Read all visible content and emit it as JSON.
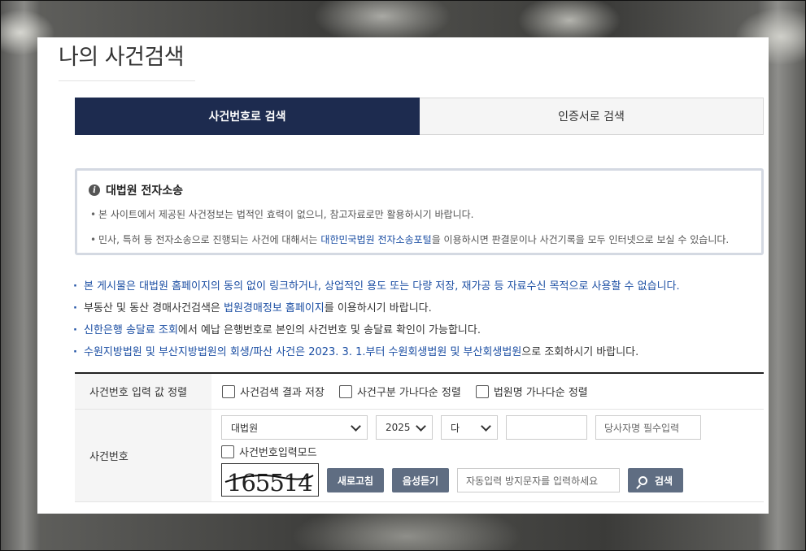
{
  "page": {
    "title": "나의 사건검색"
  },
  "tabs": [
    {
      "label": "사건번호로 검색",
      "active": true
    },
    {
      "label": "인증서로 검색",
      "active": false
    }
  ],
  "notice": {
    "title": "대법원 전자소송",
    "line1": "본 사이트에서 제공된 사건정보는 법적인 효력이 없으니, 참고자료로만 활용하시기 바랍니다.",
    "line2_pre": "민사, 특허 등 전자소송으로 진행되는 사건에 대해서는 ",
    "line2_link": "대한민국법원 전자소송포털",
    "line2_post": "을 이용하시면 판결문이나 사건기록을 모두 인터넷으로 보실 수 있습니다."
  },
  "bullets": {
    "b1": "본 게시물은 대법원 홈페이지의 동의 없이 링크하거나, 상업적인 용도 또는 다량 저장, 재가공 등 자료수신 목적으로 사용할 수 없습니다.",
    "b2_pre": "부동산 및 동산 경매사건검색은 ",
    "b2_link": "법원경매정보 홈페이지",
    "b2_post": "를 이용하시기 바랍니다.",
    "b3_link": "신한은행 송달료 조회",
    "b3_post": "에서 예납 은행번호로 본인의 사건번호 및 송달료 확인이 가능합니다.",
    "b4_pre": "수원지방법원 및 부산지방법원의 회생/파산 사건은 2023. 3. 1.부터 ",
    "b4_link": "수원회생법원 및 부산회생법원",
    "b4_post": "으로 조회하시기 바랍니다."
  },
  "form": {
    "sort_label": "사건번호 입력 값 정렬",
    "checkbox_save": "사건검색 결과 저장",
    "checkbox_type_sort": "사건구분 가나다순 정렬",
    "checkbox_court_sort": "법원명 가나다순 정렬",
    "case_label": "사건번호",
    "court_select": "대법원",
    "year_select": "2025",
    "type_select": "다",
    "case_number_value": "",
    "party_placeholder": "당사자명 필수입력",
    "input_mode_label": "사건번호입력모드",
    "captcha_text": "165514",
    "refresh_button": "새로고침",
    "audio_button": "음성듣기",
    "captcha_placeholder": "자동입력 방지문자를 입력하세요",
    "search_button": "검색"
  },
  "colors": {
    "active_tab": "#1d2b4f",
    "link_blue": "#1b4ea3",
    "button_gray": "#5f6d82"
  }
}
